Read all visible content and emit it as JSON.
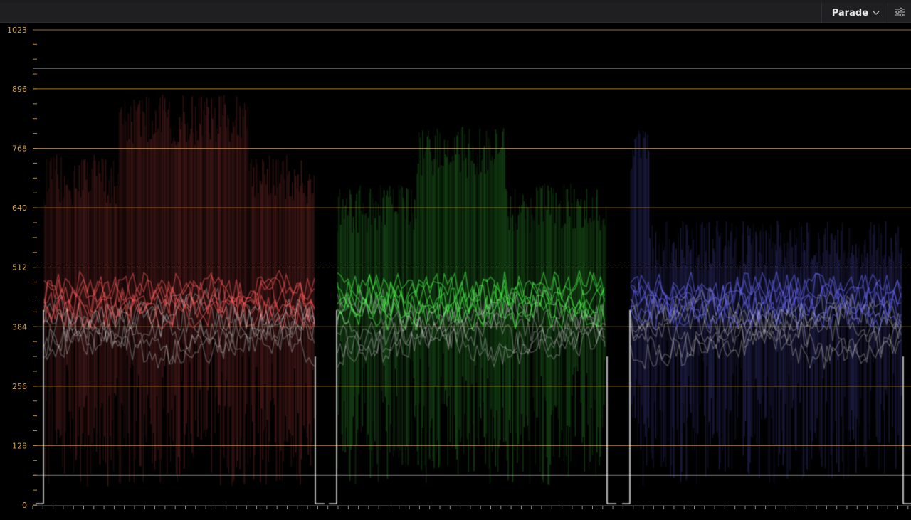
{
  "toolbar": {
    "mode_label": "Parade",
    "mode_dropdown_icon": "chevron-down-icon",
    "settings_icon": "sliders-icon"
  },
  "scope": {
    "type": "rgb-parade-waveform",
    "scale_labels": [
      "1023",
      "896",
      "768",
      "640",
      "512",
      "384",
      "256",
      "128",
      "0"
    ],
    "colors": {
      "graticule": "#b08a2e",
      "label": "#c9a24a",
      "red_trace": "#ff5a5a",
      "green_trace": "#4dff4d",
      "blue_trace": "#6a6aff"
    }
  }
}
